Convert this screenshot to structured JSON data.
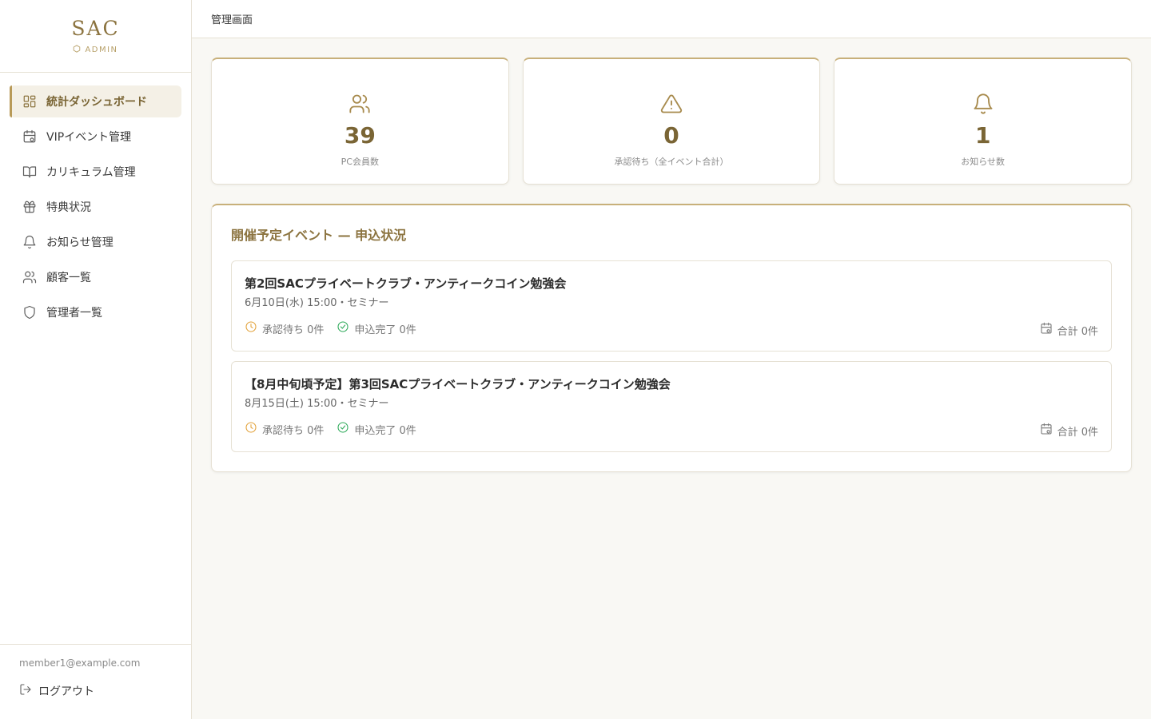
{
  "brand": {
    "title": "SAC",
    "subtitle": "ADMIN"
  },
  "sidebar": {
    "items": [
      {
        "label": "統計ダッシュボード",
        "icon": "dashboard-icon",
        "active": true
      },
      {
        "label": "VIPイベント管理",
        "icon": "calendar-icon"
      },
      {
        "label": "カリキュラム管理",
        "icon": "book-icon"
      },
      {
        "label": "特典状況",
        "icon": "gift-icon"
      },
      {
        "label": "お知らせ管理",
        "icon": "bell-icon"
      },
      {
        "label": "顧客一覧",
        "icon": "users-icon"
      },
      {
        "label": "管理者一覧",
        "icon": "shield-icon"
      }
    ],
    "user_email": "member1@example.com",
    "logout_label": "ログアウト"
  },
  "header": {
    "title": "管理画面"
  },
  "stats": [
    {
      "value": "39",
      "label": "PC会員数",
      "icon": "users-icon"
    },
    {
      "value": "0",
      "label": "承認待ち（全イベント合計）",
      "icon": "alert-triangle-icon"
    },
    {
      "value": "1",
      "label": "お知らせ数",
      "icon": "bell-icon"
    }
  ],
  "events_section": {
    "title": "開催予定イベント — 申込状況",
    "events": [
      {
        "name": "第2回SACプライベートクラブ・アンティークコイン勉強会",
        "meta": "6月10日(水) 15:00・セミナー",
        "pending": "承認待ち 0件",
        "done": "申込完了 0件",
        "total": "合計 0件"
      },
      {
        "name": "【8月中旬頃予定】第3回SACプライベートクラブ・アンティークコイン勉強会",
        "meta": "8月15日(土) 15:00・セミナー",
        "pending": "承認待ち 0件",
        "done": "申込完了 0件",
        "total": "合計 0件"
      }
    ]
  },
  "colors": {
    "accent": "#8c7440",
    "accent_light": "#c8b07a",
    "pending": "#e2a23a",
    "done": "#2eaa5a"
  }
}
